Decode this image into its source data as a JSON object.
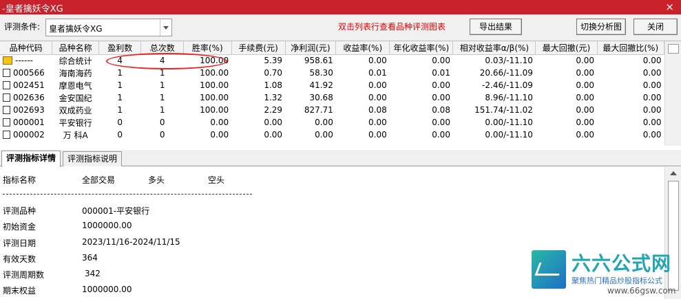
{
  "window": {
    "title": "-皇者擒妖令XG",
    "close_icon": "×"
  },
  "toolbar": {
    "condition_label": "评测条件:",
    "condition_value": "皇者擒妖令XG",
    "hint": "双击列表行查看品种评测图表",
    "export_label": "导出结果",
    "switch_label": "切换分析图",
    "close_label": "关闭"
  },
  "table": {
    "headers": [
      "品种代码",
      "品种名称",
      "盈利数",
      "总次数",
      "胜率(%)",
      "手续费(元)",
      "净利润(元)",
      "收益率(%)",
      "年化收益率(%)",
      "相对收益率α/β(%)",
      "最大回撤(元)",
      "最大回撤比(%)"
    ],
    "rows": [
      [
        "------",
        "综合统计",
        "4",
        "4",
        "100.00",
        "5.39",
        "958.61",
        "0.00",
        "0.00",
        "0.03/-11.10",
        "0.00",
        "0.00"
      ],
      [
        "000566",
        "海南海药",
        "1",
        "1",
        "100.00",
        "0.70",
        "58.30",
        "0.01",
        "0.01",
        "20.66/-11.09",
        "0.00",
        "0.00"
      ],
      [
        "002451",
        "摩恩电气",
        "1",
        "1",
        "100.00",
        "1.08",
        "41.92",
        "0.00",
        "0.00",
        "-2.46/-11.09",
        "0.00",
        "0.00"
      ],
      [
        "002636",
        "金安国纪",
        "1",
        "1",
        "100.00",
        "1.32",
        "30.68",
        "0.00",
        "0.00",
        "8.96/-11.10",
        "0.00",
        "0.00"
      ],
      [
        "002693",
        "双成药业",
        "1",
        "1",
        "100.00",
        "2.29",
        "827.71",
        "0.08",
        "0.08",
        "151.74/-11.02",
        "0.00",
        "0.00"
      ],
      [
        "000001",
        "平安银行",
        "0",
        "0",
        "0.00",
        "0.00",
        "0.00",
        "0.00",
        "0.00",
        "0.00/-11.10",
        "0.00",
        "0.00"
      ],
      [
        "000002",
        "万 科A",
        "0",
        "0",
        "0.00",
        "0.00",
        "0.00",
        "0.00",
        "0.00",
        "0.00/-11.10",
        "0.00",
        "0.00"
      ]
    ]
  },
  "tabs": [
    {
      "label": "评测指标详情",
      "active": true
    },
    {
      "label": "评测指标说明",
      "active": false
    }
  ],
  "detail": {
    "header": {
      "name": "指标名称",
      "all": "全部交易",
      "long": "多头",
      "short": "空头"
    },
    "items": [
      {
        "label": "评测品种",
        "value": "000001-平安银行"
      },
      {
        "label": "初始资金",
        "value": "1000000.00"
      },
      {
        "label": "评测日期",
        "value": "2023/11/16-2024/11/15"
      },
      {
        "label": "有效天数",
        "value": "364"
      },
      {
        "label": "评测周期数",
        "value": "342"
      },
      {
        "label": "期末权益",
        "value": "1000000.00"
      }
    ]
  },
  "watermark": {
    "name": "六六公式网",
    "slogan": "聚焦热门精品炒股指标公式",
    "site": "www.66gsw.com"
  },
  "colors": {
    "titlebar": "#c9222c",
    "hint": "#e00000",
    "highlight_oval": "#ee2222"
  }
}
